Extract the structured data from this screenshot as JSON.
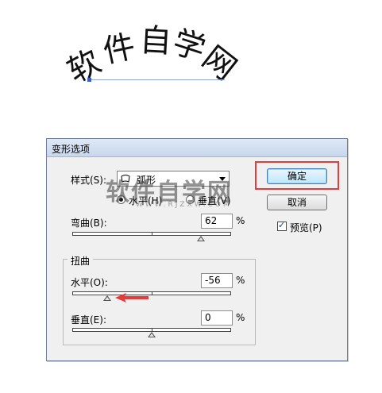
{
  "artwork": {
    "arc_chars": [
      "软",
      "件",
      "自",
      "学",
      "网"
    ]
  },
  "dialog": {
    "title": "变形选项",
    "style_label": "样式(S):",
    "style_value": "弧形",
    "horizontal_label": "水平(H)",
    "vertical_label": "垂直(V)",
    "bend_label": "弯曲(B):",
    "bend_value": "62",
    "percent": "%",
    "distortion_group_label": "扭曲",
    "horiz_distort_label": "水平(O):",
    "horiz_distort_value": "-56",
    "vert_distort_label": "垂直(E):",
    "vert_distort_value": "0",
    "ok_label": "确定",
    "cancel_label": "取消",
    "preview_label": "预览(P)",
    "preview_checked": true,
    "orientation_selected": "horizontal"
  },
  "sliders": {
    "bend_percent": 62,
    "horiz_distort_percent": -56,
    "vert_distort_percent": 0
  },
  "watermark": {
    "text": "软件自学网",
    "sub": "WWW.RJZXW.COM"
  },
  "colors": {
    "highlight_box": "#e83a3a",
    "arrow": "#e83a3a",
    "default_button": "#bee6fd"
  }
}
